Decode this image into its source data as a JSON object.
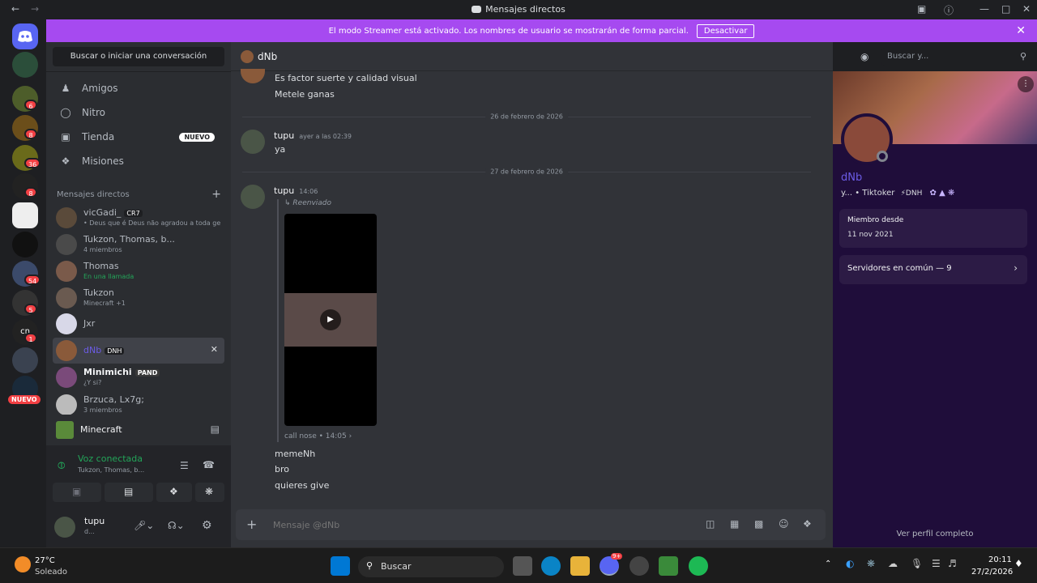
{
  "window": {
    "title": "Mensajes directos"
  },
  "streamer_banner": {
    "text": "El modo Streamer está activado. Los nombres de usuario se mostrarán de forma parcial.",
    "button": "Desactivar"
  },
  "guild_badges": [
    "6",
    "8",
    "36",
    "8",
    "54",
    "5",
    "1",
    "NUEVO"
  ],
  "guild_label_cn": "cn",
  "sidebar": {
    "search": "Buscar o iniciar una conversación",
    "nav": [
      {
        "label": "Amigos"
      },
      {
        "label": "Nitro"
      },
      {
        "label": "Tienda",
        "badge": "NUEVO"
      },
      {
        "label": "Misiones"
      }
    ],
    "dm_header": "Mensajes directos",
    "dms": [
      {
        "name": "vicGadi_",
        "tag": "CR7",
        "sub": "• Deus que é Deus não agradou a toda ge"
      },
      {
        "name": "Tukzon, Thomas, b...",
        "sub": "4 miembros"
      },
      {
        "name": "Thomas",
        "sub": "En una llamada"
      },
      {
        "name": "Tukzon",
        "sub": "Minecraft +1"
      },
      {
        "name": "Jxr",
        "sub": ""
      },
      {
        "name": "dNb",
        "tag": "DNH",
        "sub": ""
      },
      {
        "name": "Minimichi",
        "tag": "PAND",
        "sub": "¿Y si?"
      },
      {
        "name": "Brzuca, Lx7g;",
        "sub": "3 miembros"
      }
    ],
    "activity": "Minecraft",
    "voice": {
      "status": "Voz conectada",
      "channel": "Tukzon, Thomas, b..."
    },
    "user": {
      "name": "tupu",
      "status": "d..."
    }
  },
  "chat": {
    "header_name": "dNb",
    "search_placeholder": "Buscar y...",
    "msgs_top": [
      "Es factor suerte y calidad visual",
      "Metele ganas"
    ],
    "date1": "26 de febrero de 2026",
    "m1": {
      "author": "tupu",
      "time": "ayer a las 02:39",
      "text": "ya"
    },
    "date2": "27 de febrero de 2026",
    "m2": {
      "author": "tupu",
      "time": "14:06",
      "forwarded": "Reenviado",
      "origin": "call nose",
      "origin_time": "14:05"
    },
    "tail": [
      "memeNh",
      "bro",
      "quieres give"
    ],
    "composer_placeholder": "Mensaje @dNb"
  },
  "profile": {
    "name": "dNb",
    "bio": "y... • Tiktoker",
    "tag": "DNH",
    "member_label": "Miembro desde",
    "member_date": "11 nov 2021",
    "servers": "Servidores en común — 9",
    "full": "Ver perfil completo"
  },
  "taskbar": {
    "weather_temp": "27°C",
    "weather_desc": "Soleado",
    "search": "Buscar",
    "discord_badge": "9+",
    "time": "20:11",
    "date": "27/2/2026"
  }
}
